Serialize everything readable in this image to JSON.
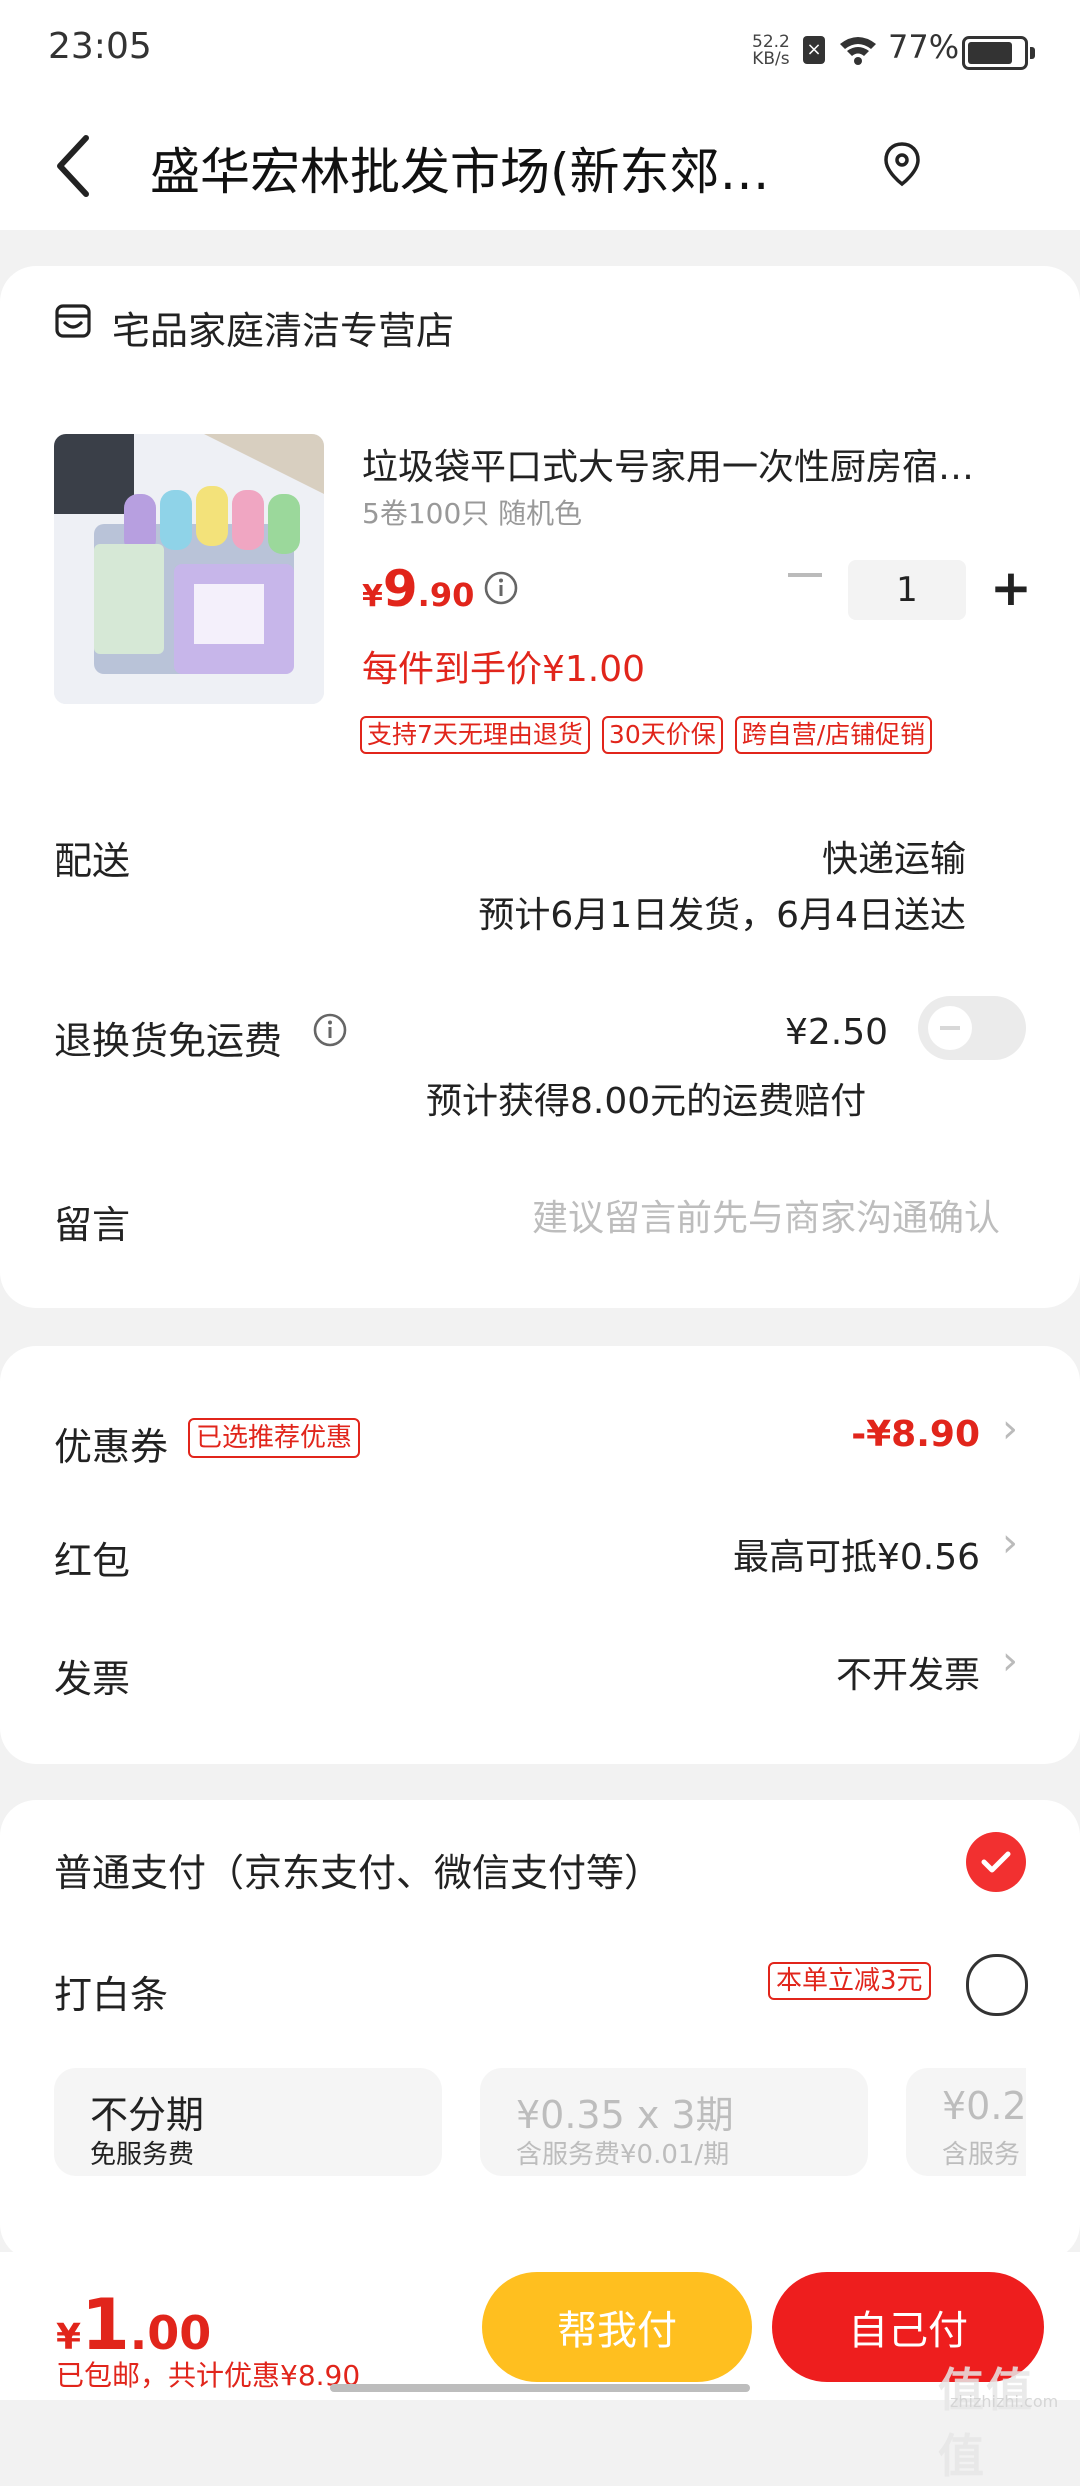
{
  "status_bar": {
    "time": "23:05",
    "net_speed": "52.2",
    "net_unit": "KB/s",
    "battery": "77%"
  },
  "header": {
    "title": "盛华宏林批发市场(新东郊…"
  },
  "shop": {
    "name": "宅品家庭清洁专营店"
  },
  "product": {
    "title": "垃圾袋平口式大号家用一次性厨房宿…",
    "spec": "5卷100只 随机色",
    "price_symbol": "¥",
    "price_int": "9",
    "price_dec": ".90",
    "quantity": "1",
    "unit_price": "每件到手价¥1.00",
    "tags": [
      "支持7天无理由退货",
      "30天价保",
      "跨自营/店铺促销"
    ]
  },
  "delivery": {
    "label": "配送",
    "method": "快递运输",
    "eta": "预计6月1日发货，6月4日送达"
  },
  "return_shipping": {
    "label": "退换货免运费",
    "price": "¥2.50",
    "note": "预计获得8.00元的运费赔付",
    "enabled": false
  },
  "message": {
    "label": "留言",
    "placeholder": "建议留言前先与商家沟通确认"
  },
  "discounts": {
    "coupon_label": "优惠券",
    "coupon_tag": "已选推荐优惠",
    "coupon_value": "-¥8.90",
    "redpacket_label": "红包",
    "redpacket_value": "最高可抵¥0.56",
    "invoice_label": "发票",
    "invoice_value": "不开发票"
  },
  "payment": {
    "normal_label": "普通支付（京东支付、微信支付等）",
    "baitiao_label": "打白条",
    "baitiao_tag": "本单立减3元",
    "installments": [
      {
        "title": "不分期",
        "sub": "免服务费"
      },
      {
        "title": "¥0.35 x 3期",
        "sub": "含服务费¥0.01/期"
      },
      {
        "title": "¥0.2",
        "sub": "含服务"
      }
    ]
  },
  "bottom": {
    "total_symbol": "¥",
    "total_int": "1",
    "total_dec": ".00",
    "sub": "已包邮，共计优惠¥8.90",
    "help_pay": "帮我付",
    "self_pay": "自己付"
  },
  "watermark": {
    "text": "值值值",
    "url": "zhizhizhi.com"
  },
  "colors": {
    "accent_red": "#e1251b",
    "help_button": "#ffbf1f",
    "self_button": "#ee1e1e"
  }
}
